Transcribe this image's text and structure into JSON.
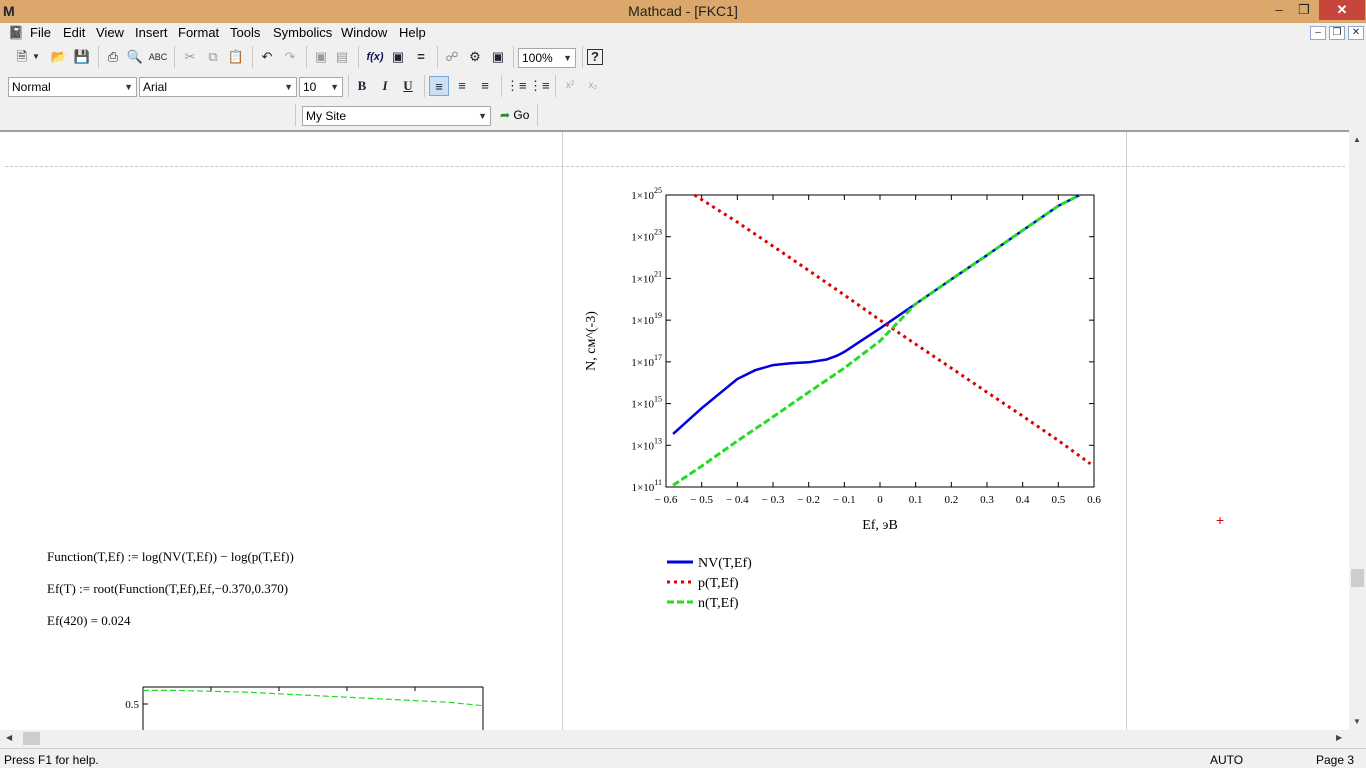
{
  "window": {
    "title": "Mathcad - [FKC1]",
    "app_icon": "mathcad-icon"
  },
  "menu": [
    "File",
    "Edit",
    "View",
    "Insert",
    "Format",
    "Tools",
    "Symbolics",
    "Window",
    "Help"
  ],
  "toolbar": {
    "zoom": "100%",
    "zoom_options": [
      "100%"
    ]
  },
  "format_toolbar": {
    "style": "Normal",
    "font": "Arial",
    "size": "10",
    "bold": "B",
    "italic": "I",
    "underline": "U"
  },
  "resources_toolbar": {
    "site": "My Site",
    "go_label": "Go"
  },
  "worksheet": {
    "function_def": "Function(T,Ef) := log(NV(T,Ef)) − log(p(T,Ef))",
    "root_def": "Ef(T) := root(Function(T,Ef),Ef,−0.370,0.370)",
    "eval": "Ef(420) = 0.024"
  },
  "chart_data": [
    {
      "type": "line",
      "title": "",
      "xlabel": "Ef, эВ",
      "ylabel": "N, см^(-3)",
      "xlim": [
        -0.6,
        0.6
      ],
      "ylim": [
        100000000000.0,
        1e+25
      ],
      "y_scale": "log",
      "x_ticks": [
        "− 0.6",
        "− 0.5",
        "− 0.4",
        "− 0.3",
        "− 0.2",
        "− 0.1",
        "0",
        "0.1",
        "0.2",
        "0.3",
        "0.4",
        "0.5",
        "0.6"
      ],
      "y_ticks": [
        {
          "base": "1×10",
          "exp": "25"
        },
        {
          "base": "1×10",
          "exp": "23"
        },
        {
          "base": "1×10",
          "exp": "21"
        },
        {
          "base": "1×10",
          "exp": "19"
        },
        {
          "base": "1×10",
          "exp": "17"
        },
        {
          "base": "1×10",
          "exp": "15"
        },
        {
          "base": "1×10",
          "exp": "13"
        },
        {
          "base": "1×10",
          "exp": "11"
        }
      ],
      "legend_position": "bottom-left",
      "series": [
        {
          "name": "NV(T,Ef)",
          "color": "#0000dd",
          "style": "solid",
          "x": [
            -0.58,
            -0.5,
            -0.4,
            -0.35,
            -0.3,
            -0.25,
            -0.2,
            -0.15,
            -0.12,
            -0.1,
            -0.05,
            0,
            0.1,
            0.2,
            0.3,
            0.4,
            0.5,
            0.56
          ],
          "y": [
            35000000000000.0,
            600000000000000.0,
            1.5e+16,
            4e+16,
            7e+16,
            8.5e+16,
            9.5e+16,
            1.3e+17,
            2e+17,
            3e+17,
            1.1e+18,
            4e+18,
            6e+19,
            9e+20,
            1.3e+22,
            2e+23,
            3e+24,
            1e+25
          ]
        },
        {
          "name": "p(T,Ef)",
          "color": "#dd0000",
          "style": "dotted",
          "x": [
            -0.52,
            -0.4,
            -0.3,
            -0.2,
            -0.1,
            0,
            0.1,
            0.2,
            0.3,
            0.4,
            0.5,
            0.59
          ],
          "y": [
            1e+25,
            5e+23,
            3.5e+22,
            2.4e+21,
            1.6e+20,
            1e+19,
            7e+17,
            5e+16,
            3500000000000000.0,
            250000000000000.0,
            17000000000000.0,
            1300000000000.0
          ]
        },
        {
          "name": "n(T,Ef)",
          "color": "#22dd22",
          "style": "dashed",
          "x": [
            -0.58,
            -0.5,
            -0.4,
            -0.3,
            -0.2,
            -0.1,
            0,
            0.1,
            0.2,
            0.3,
            0.4,
            0.5,
            0.56
          ],
          "y": [
            120000000000.0,
            1000000000000.0,
            16000000000000.0,
            230000000000000.0,
            3500000000000000.0,
            5e+16,
            1e+18,
            6e+19,
            9e+20,
            1.3e+22,
            2e+23,
            3e+24,
            1e+25
          ]
        }
      ]
    },
    {
      "type": "line",
      "title": "",
      "y_ticks": [
        "0.5"
      ],
      "series": [
        {
          "name": "",
          "color": "#22dd22",
          "style": "dashed",
          "x": [
            0,
            0.1,
            0.2,
            0.3,
            0.4,
            0.5,
            0.6,
            0.7,
            0.8,
            0.9,
            1
          ],
          "y": [
            0.58,
            0.58,
            0.575,
            0.57,
            0.56,
            0.55,
            0.54,
            0.53,
            0.52,
            0.51,
            0.49
          ]
        }
      ]
    }
  ],
  "status": {
    "help": "Press F1 for help.",
    "mode": "AUTO",
    "page": "Page 3"
  }
}
